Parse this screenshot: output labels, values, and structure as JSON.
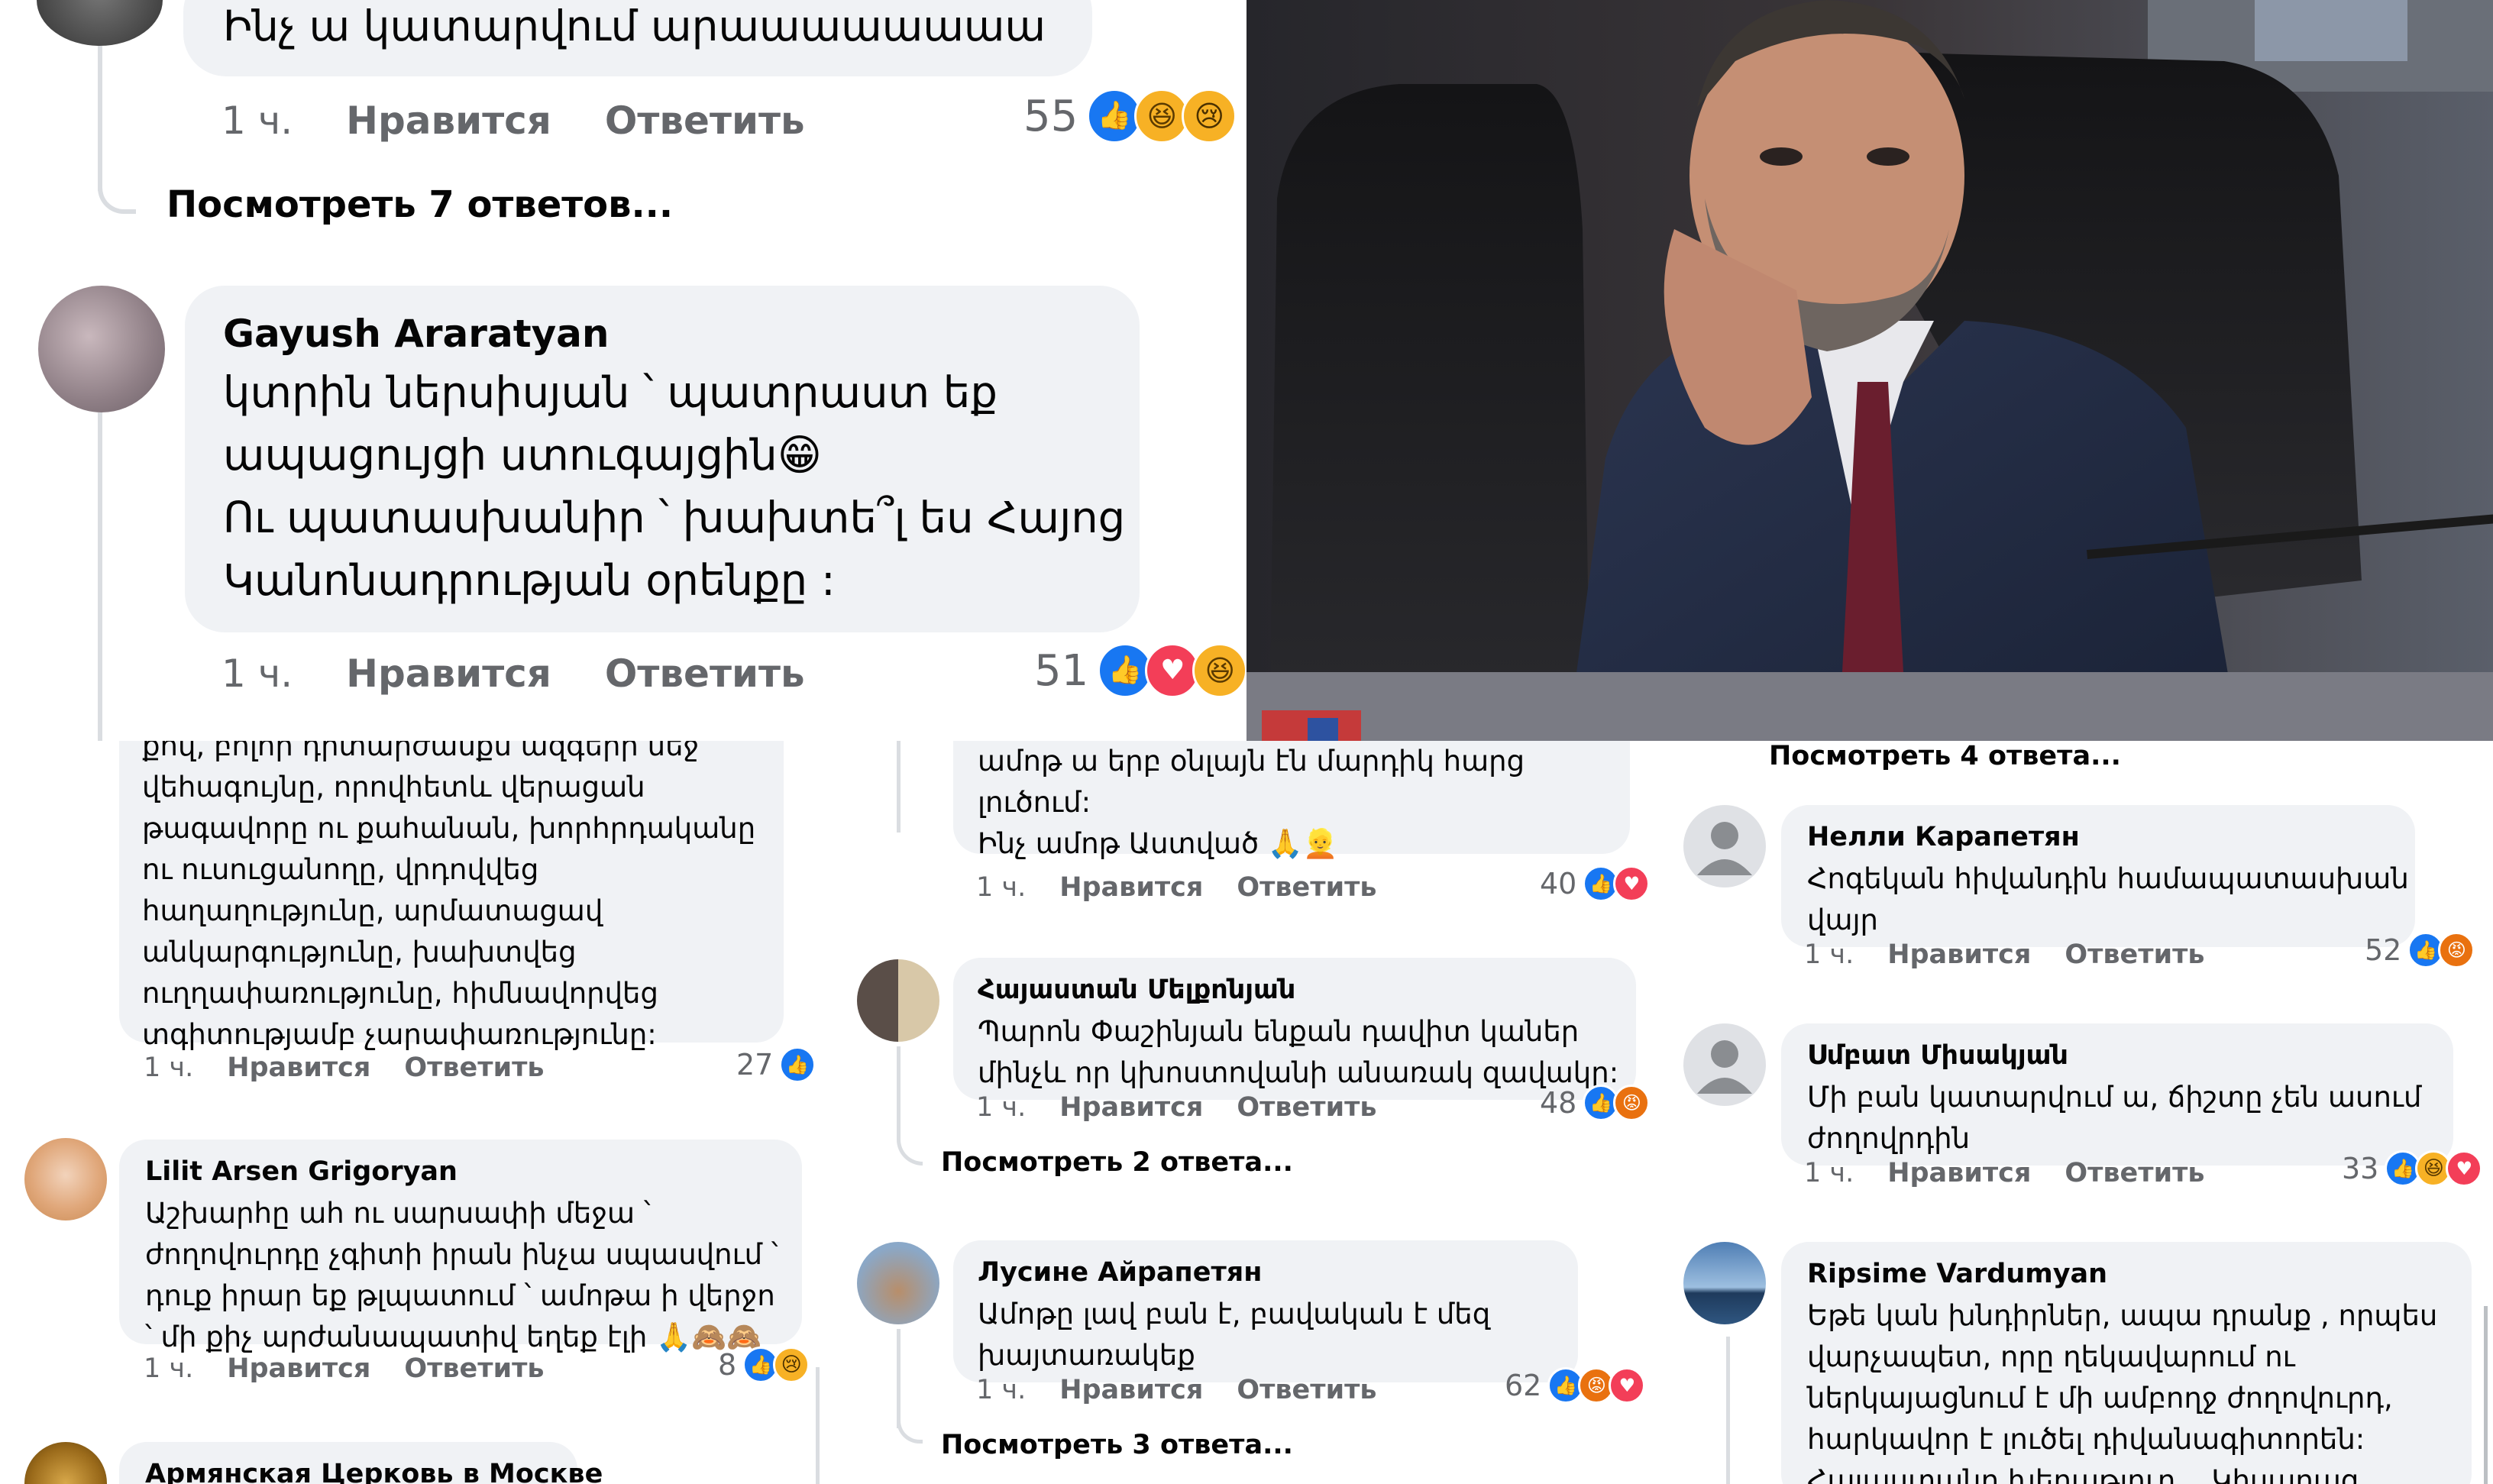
{
  "ui": {
    "like": "Нравится",
    "reply": "Ответить",
    "time": "1 ч."
  },
  "colors": {
    "like_blue": "#1877f2",
    "love_red": "#f33e58",
    "bubble": "#f0f2f5",
    "meta_gray": "#65676b"
  },
  "top": {
    "c1": {
      "text": "Ինչ ա կատարվում արաաաաաաաա",
      "count": "55",
      "reactions": [
        "like",
        "haha",
        "sad"
      ]
    },
    "view_replies": "Посмотреть 7 ответов...",
    "c2": {
      "author": "Gayush Araratyan",
      "text": "կտրին ներսիսյան ՝ պատրաստ եք\nապացույցի ստուգայցին😁\nՈւ պատասխանիր ՝ խախտե՞լ ես Հայոց\nԿանոնադրության օրենքը :",
      "count": "51",
      "reactions": [
        "like",
        "love",
        "haha"
      ]
    }
  },
  "left": {
    "c1": {
      "text": "քով, բոլոր դիտարժանքն ազգերի մեջ\nվեհագույնը, որովհետև վերացան\nթագավորը ու քահանան, խորհրդականը\nու ուսուցանողը, վրդովվեց\nհաղաղությունը, արմատացավ\nանկարգությունը, խախտվեց\nուղղափառությունը, հիմնավորվեց\nտգիտությամբ չարափառությունը:",
      "count": "27",
      "reactions": [
        "like"
      ]
    },
    "c2": {
      "author": "Lilit Arsen Grigoryan",
      "text": "Աշխարհը ահ ու սարսափի մեջա ՝\nժողովուրդը չգիտի իրան ինչա սպասվում ՝\nդուք իրար եք թլպատում ՝ ամոթա ի վերջո\n՝ մի քիչ արժանապատիվ եղեք էլի 🙏🙈🙈",
      "count": "8",
      "reactions": [
        "like",
        "sad"
      ]
    },
    "c3": {
      "author": "Армянская Церковь в Москве"
    }
  },
  "mid": {
    "c1": {
      "text": "ամոթ ա երբ օնլայն էն մարդիկ հարց\nլուծում:\nԻնչ ամոթ Աստված 🙏👱",
      "count": "40",
      "reactions": [
        "like",
        "love"
      ]
    },
    "c2": {
      "author": "Հայաստան Մելքոնյան",
      "text": "Պարոն Փաշինյան ենքան դավիտ կաներ\nմինչև որ կխոստովանի անառակ զավակը:",
      "count": "48",
      "reactions": [
        "like",
        "angry"
      ]
    },
    "view_replies_1": "Посмотреть 2 ответа...",
    "c3": {
      "author": "Лусине Айрапетян",
      "text": "Ամոթը լավ բան է, բավական է մեզ\nխայտառակեք",
      "count": "62",
      "reactions": [
        "like",
        "angry",
        "love"
      ]
    },
    "view_replies_2": "Посмотреть 3 ответа..."
  },
  "right": {
    "view_replies": "Посмотреть 4 ответа...",
    "c1": {
      "author": "Нелли Карапетян",
      "text": "Հոգեկան հիվանդին համապատասխան\nվայր",
      "count": "52",
      "reactions": [
        "like",
        "angry"
      ]
    },
    "c2": {
      "author": "Սմբատ Միսակյան",
      "text": "Մի բան կատարվում ա, ճիշտը չեն ասում\nժողովրդին",
      "count": "33",
      "reactions": [
        "like",
        "haha",
        "love"
      ]
    },
    "c3": {
      "author": "Ripsime Vardumyan",
      "text": "Եթե կան խնդիրներ, ապա դրանք , որպես\nվարչապետ, որը ղեկավարում ու\nներկայացնում է մի ամբողջ ժողովուրդ,\nհարկավոր է լուծել դիվանագիտորեն:\nՀայաստանը խեղաթյուր... Կիսարաց"
    }
  }
}
